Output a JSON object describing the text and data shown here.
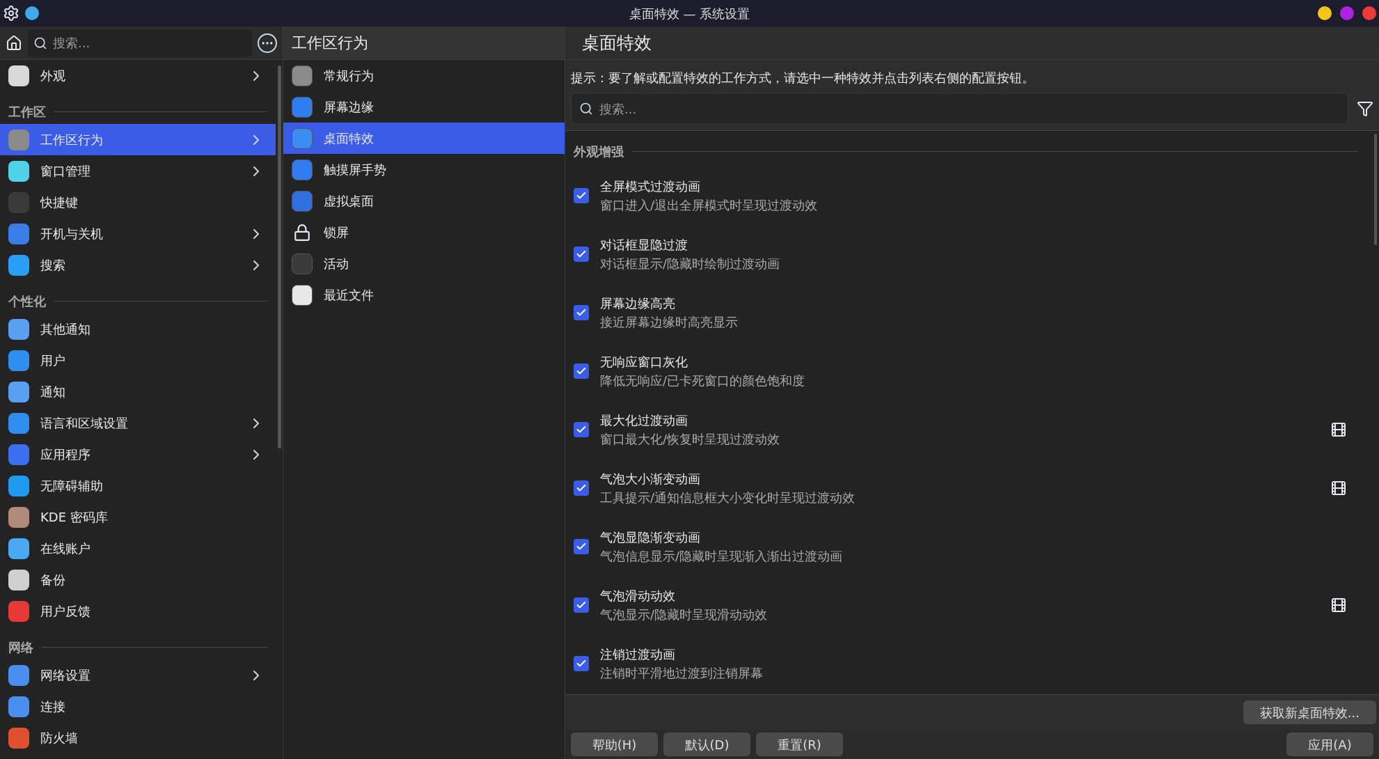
{
  "window": {
    "title": "桌面特效 — 系统设置"
  },
  "sidebar": {
    "search": {
      "placeholder": "搜索..."
    },
    "sections": [
      {
        "items": [
          {
            "label": "外观",
            "selected": false,
            "submenu": true
          }
        ]
      },
      {
        "heading": "工作区",
        "items": [
          {
            "label": "工作区行为",
            "selected": true,
            "submenu": true
          },
          {
            "label": "窗口管理",
            "selected": false,
            "submenu": true
          },
          {
            "label": "快捷键",
            "selected": false,
            "submenu": false
          },
          {
            "label": "开机与关机",
            "selected": false,
            "submenu": true
          },
          {
            "label": "搜索",
            "selected": false,
            "submenu": true
          }
        ]
      },
      {
        "heading": "个性化",
        "items": [
          {
            "label": "其他通知",
            "selected": false,
            "submenu": false
          },
          {
            "label": "用户",
            "selected": false,
            "submenu": false
          },
          {
            "label": "通知",
            "selected": false,
            "submenu": false
          },
          {
            "label": "语言和区域设置",
            "selected": false,
            "submenu": true
          },
          {
            "label": "应用程序",
            "selected": false,
            "submenu": true
          },
          {
            "label": "无障碍辅助",
            "selected": false,
            "submenu": false
          },
          {
            "label": "KDE 密码库",
            "selected": false,
            "submenu": false
          },
          {
            "label": "在线账户",
            "selected": false,
            "submenu": false
          },
          {
            "label": "备份",
            "selected": false,
            "submenu": false
          },
          {
            "label": "用户反馈",
            "selected": false,
            "submenu": false
          }
        ]
      },
      {
        "heading": "网络",
        "items": [
          {
            "label": "网络设置",
            "selected": false,
            "submenu": true
          },
          {
            "label": "连接",
            "selected": false,
            "submenu": false
          },
          {
            "label": "防火墙",
            "selected": false,
            "submenu": false
          }
        ]
      }
    ]
  },
  "category": {
    "title": "工作区行为",
    "items": [
      {
        "label": "常规行为",
        "selected": false
      },
      {
        "label": "屏幕边缘",
        "selected": false
      },
      {
        "label": "桌面特效",
        "selected": true
      },
      {
        "label": "触摸屏手势",
        "selected": false
      },
      {
        "label": "虚拟桌面",
        "selected": false
      },
      {
        "label": "锁屏",
        "selected": false
      },
      {
        "label": "活动",
        "selected": false
      },
      {
        "label": "最近文件",
        "selected": false
      }
    ]
  },
  "page": {
    "title": "桌面特效",
    "hint": "提示：要了解或配置特效的工作方式，请选中一种特效并点击列表右侧的配置按钮。",
    "search": {
      "placeholder": "搜索..."
    },
    "group": "外观增强",
    "effects": [
      {
        "name": "全屏模式过渡动画",
        "description": "窗口进入/退出全屏模式时呈现过渡动效",
        "checked": true,
        "video": false
      },
      {
        "name": "对话框显隐过渡",
        "description": "对话框显示/隐藏时绘制过渡动画",
        "checked": true,
        "video": false
      },
      {
        "name": "屏幕边缘高亮",
        "description": "接近屏幕边缘时高亮显示",
        "checked": true,
        "video": false
      },
      {
        "name": "无响应窗口灰化",
        "description": "降低无响应/已卡死窗口的颜色饱和度",
        "checked": true,
        "video": false
      },
      {
        "name": "最大化过渡动画",
        "description": "窗口最大化/恢复时呈现过渡动效",
        "checked": true,
        "video": true
      },
      {
        "name": "气泡大小渐变动画",
        "description": "工具提示/通知信息框大小变化时呈现过渡动效",
        "checked": true,
        "video": true
      },
      {
        "name": "气泡显隐渐变动画",
        "description": "气泡信息显示/隐藏时呈现渐入渐出过渡动画",
        "checked": true,
        "video": false
      },
      {
        "name": "气泡滑动动效",
        "description": "气泡显示/隐藏时呈现滑动动效",
        "checked": true,
        "video": true
      },
      {
        "name": "注销过渡动画",
        "description": "注销时平滑地过渡到注销屏幕",
        "checked": true,
        "video": false
      }
    ],
    "get_new": "获取新桌面特效...",
    "buttons": [
      "帮助(H)",
      "默认(D)",
      "重置(R)"
    ],
    "apply": "应用(A)"
  }
}
